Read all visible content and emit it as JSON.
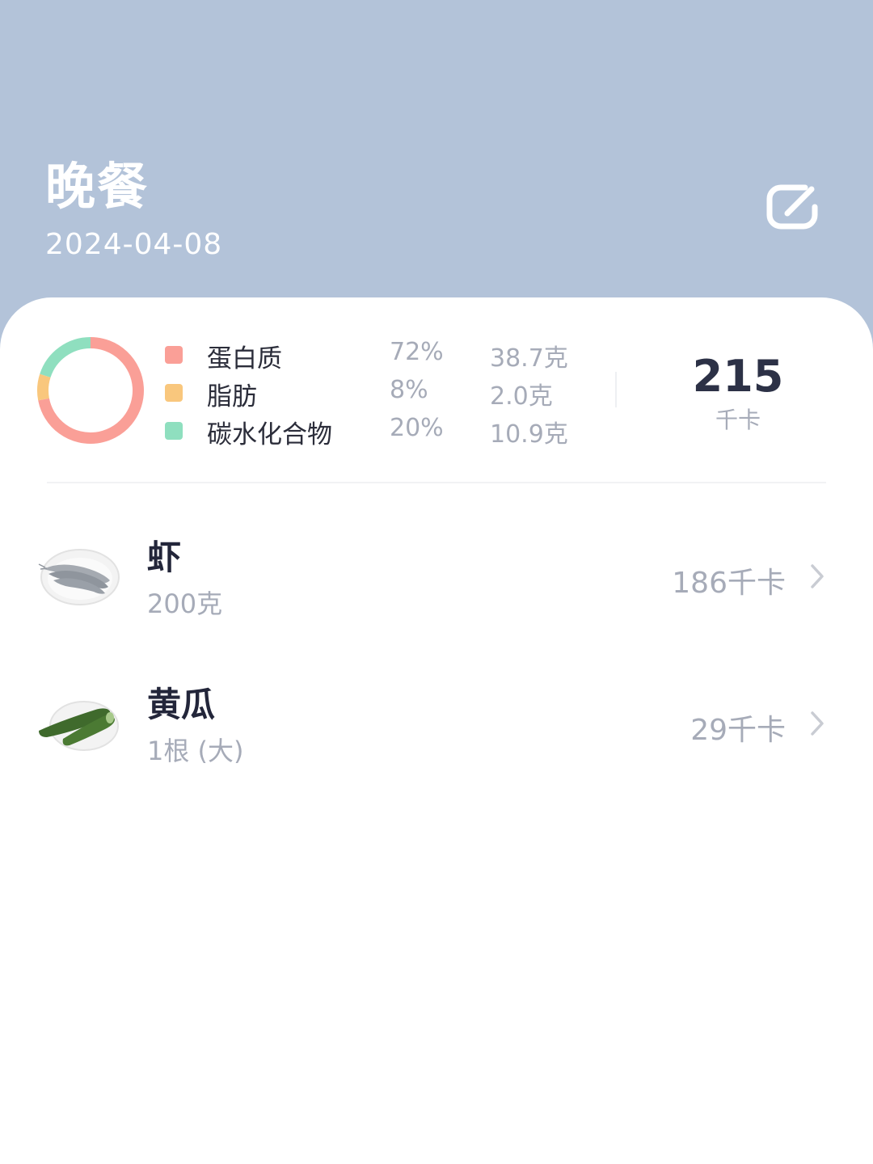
{
  "header": {
    "title": "晚餐",
    "date": "2024-04-08",
    "edit_icon": "edit-icon"
  },
  "nutrition": {
    "items": [
      {
        "name": "蛋白质",
        "percent": "72%",
        "amount": "38.7克",
        "color": "#fa9f97",
        "share": 72
      },
      {
        "name": "脂肪",
        "percent": "8%",
        "amount": "2.0克",
        "color": "#f9c77d",
        "share": 8
      },
      {
        "name": "碳水化合物",
        "percent": "20%",
        "amount": "10.9克",
        "color": "#8fdfbf",
        "share": 20
      }
    ],
    "total_kcal": "215",
    "kcal_unit": "千卡"
  },
  "foods": [
    {
      "name": "虾",
      "amount": "200克",
      "kcal": "186千卡",
      "image_icon": "shrimp-plate-icon"
    },
    {
      "name": "黄瓜",
      "amount": "1根 (大)",
      "kcal": "29千卡",
      "image_icon": "cucumber-plate-icon"
    }
  ],
  "colors": {
    "header_bg": "#b3c3d9",
    "card_bg": "#ffffff",
    "text_primary": "#23263a",
    "text_secondary": "#a6abb8"
  }
}
